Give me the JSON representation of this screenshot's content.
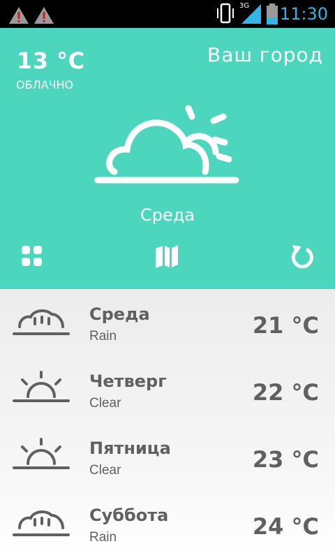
{
  "status_bar": {
    "time": "11:30",
    "network": "3G",
    "icons": [
      "warning-icon",
      "warning-icon",
      "vibrate-icon",
      "signal-icon",
      "battery-icon"
    ]
  },
  "current": {
    "temperature": "13 °C",
    "condition": "ОБЛАЧНО",
    "city": "Ваш город",
    "day": "Среда",
    "icon": "partly-cloudy-icon"
  },
  "toolbar": {
    "buttons": [
      "grid-icon",
      "map-icon",
      "refresh-icon"
    ]
  },
  "forecast": [
    {
      "day": "Среда",
      "description": "Rain",
      "temperature": "21 °C",
      "icon": "rain-icon"
    },
    {
      "day": "Четверг",
      "description": "Clear",
      "temperature": "22 °C",
      "icon": "sunrise-icon"
    },
    {
      "day": "Пятница",
      "description": "Clear",
      "temperature": "23 °C",
      "icon": "sunrise-icon"
    },
    {
      "day": "Суббота",
      "description": "Rain",
      "temperature": "24 °C",
      "icon": "rain-icon"
    }
  ],
  "colors": {
    "accent": "#4cd6bd",
    "text_dark": "#606060",
    "status_time": "#33b5e5"
  }
}
